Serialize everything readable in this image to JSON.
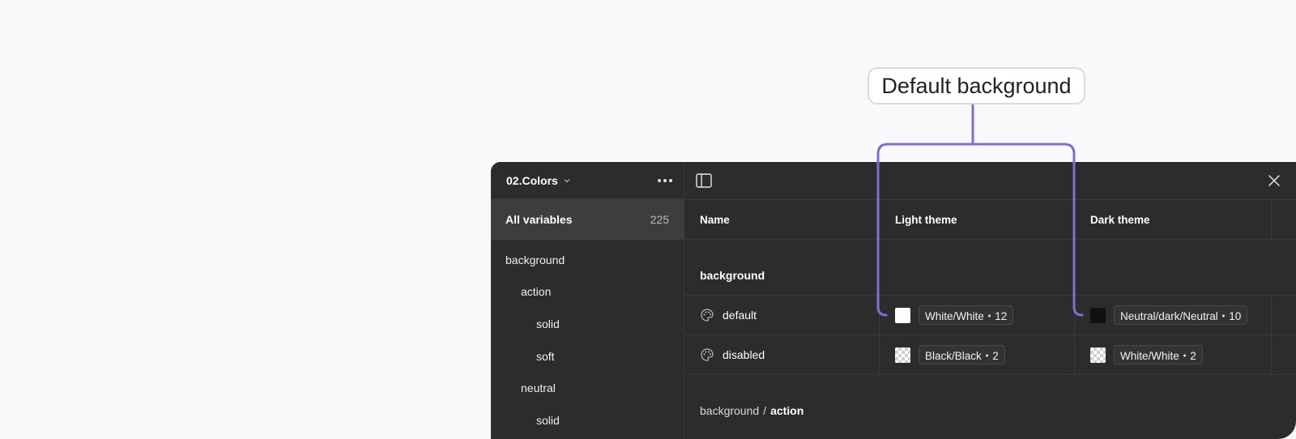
{
  "callout": {
    "label": "Default background",
    "stroke_color": "#7b6fd6"
  },
  "sidebar": {
    "collection_name": "02.Colors",
    "all_variables_label": "All variables",
    "all_variables_count": "225",
    "items": [
      {
        "label": "background"
      },
      {
        "label": "action"
      },
      {
        "label": "solid"
      },
      {
        "label": "soft"
      },
      {
        "label": "neutral"
      },
      {
        "label": "solid"
      }
    ]
  },
  "table": {
    "columns": [
      "Name",
      "Light theme",
      "Dark theme"
    ],
    "group_label": "background",
    "rows": [
      {
        "name": "default",
        "light": {
          "swatch_color": "#ffffff",
          "value": "White/White・12"
        },
        "dark": {
          "swatch_color": "#111111",
          "value": "Neutral/dark/Neutral・10"
        }
      },
      {
        "name": "disabled",
        "light": {
          "swatch_color": "checker",
          "value": "Black/Black・2"
        },
        "dark": {
          "swatch_color": "checker",
          "value": "White/White・2"
        }
      }
    ],
    "breadcrumb": {
      "parent": "background",
      "separator": "/",
      "current": "action"
    }
  },
  "colors": {
    "panel_bg": "#2c2c2c",
    "page_bg": "#f8f9fb",
    "accent": "#7b6fd6"
  }
}
